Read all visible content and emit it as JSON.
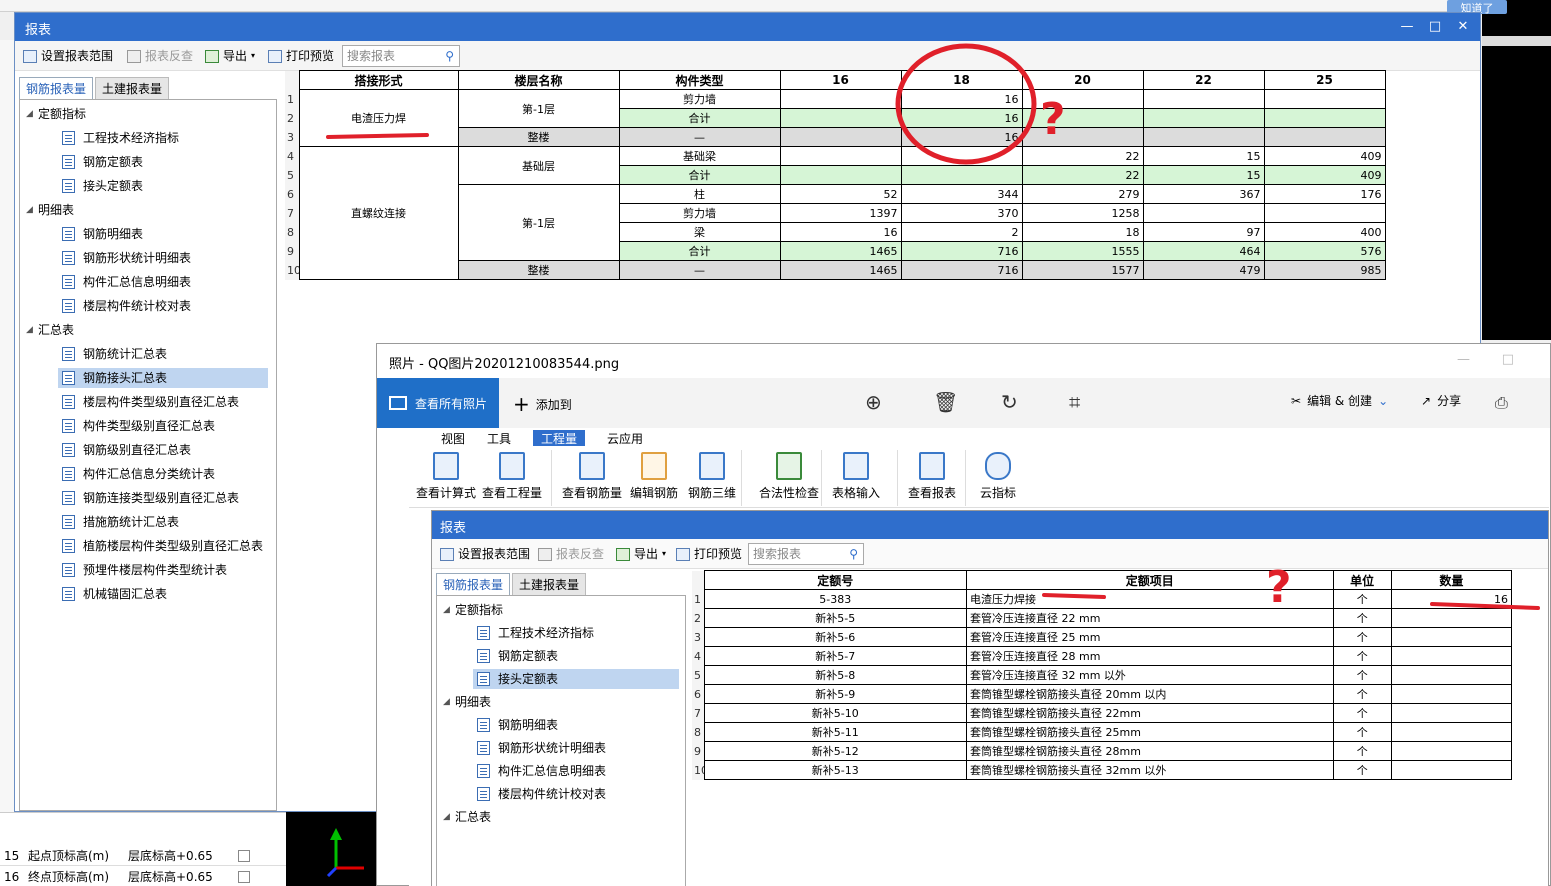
{
  "top_hint": "知道了",
  "bg_left_rows": [
    "15",
    "16"
  ],
  "bg_left_labels": [
    {
      "name": "起点顶标高(m)",
      "value": "层底标高+0.65"
    },
    {
      "name": "终点顶标高(m)",
      "value": "层底标高+0.65"
    }
  ],
  "report": {
    "title": "报表",
    "toolbar": {
      "set_range": "设置报表范围",
      "reverse": "报表反查",
      "export": "导出",
      "print_preview": "打印预览",
      "search_placeholder": "搜索报表"
    },
    "tabs": [
      "钢筋报表量",
      "土建报表量"
    ],
    "tree": {
      "g1": "定额指标",
      "g1_items": [
        "工程技术经济指标",
        "钢筋定额表",
        "接头定额表"
      ],
      "g2": "明细表",
      "g2_items": [
        "钢筋明细表",
        "钢筋形状统计明细表",
        "构件汇总信息明细表",
        "楼层构件统计校对表"
      ],
      "g3": "汇总表",
      "g3_items": [
        "钢筋统计汇总表",
        "钢筋接头汇总表",
        "楼层构件类型级别直径汇总表",
        "构件类型级别直径汇总表",
        "钢筋级别直径汇总表",
        "构件汇总信息分类统计表",
        "钢筋连接类型级别直径汇总表",
        "措施筋统计汇总表",
        "植筋楼层构件类型级别直径汇总表",
        "预埋件楼层构件类型统计表",
        "机械锚固汇总表"
      ]
    },
    "headers": [
      "搭接形式",
      "楼层名称",
      "构件类型",
      "16",
      "18",
      "20",
      "22",
      "25"
    ],
    "rows": [
      {
        "n": "1",
        "type": "剪力墙",
        "v": [
          "",
          "16",
          "",
          "",
          ""
        ]
      },
      {
        "n": "2",
        "type": "合计",
        "v": [
          "",
          "16",
          "",
          "",
          ""
        ]
      },
      {
        "n": "3",
        "type": "—",
        "v": [
          "",
          "16",
          "",
          "",
          ""
        ]
      },
      {
        "n": "4",
        "type": "基础梁",
        "v": [
          "",
          "",
          "22",
          "15",
          "409"
        ]
      },
      {
        "n": "5",
        "type": "合计",
        "v": [
          "",
          "",
          "22",
          "15",
          "409"
        ]
      },
      {
        "n": "6",
        "type": "柱",
        "v": [
          "52",
          "344",
          "279",
          "367",
          "176"
        ]
      },
      {
        "n": "7",
        "type": "剪力墙",
        "v": [
          "1397",
          "370",
          "1258",
          "",
          ""
        ]
      },
      {
        "n": "8",
        "type": "梁",
        "v": [
          "16",
          "2",
          "18",
          "97",
          "400"
        ]
      },
      {
        "n": "9",
        "type": "合计",
        "v": [
          "1465",
          "716",
          "1555",
          "464",
          "576"
        ]
      },
      {
        "n": "10",
        "type": "—",
        "v": [
          "1465",
          "716",
          "1577",
          "479",
          "985"
        ]
      }
    ],
    "merge": {
      "form1": "电渣压力焊",
      "form2": "直螺纹连接",
      "floor_b1": "第-1层",
      "whole": "整楼",
      "base": "基础层",
      "floor_b1b": "第-1层",
      "whole2": "整楼"
    }
  },
  "photos": {
    "title": "照片 - QQ图片20201210083544.png",
    "view_all": "查看所有照片",
    "add_to": "添加到",
    "edit_create": "编辑 & 创建",
    "share": "分享",
    "ribbon_tabs": [
      "视图",
      "工具",
      "工程量",
      "云应用"
    ],
    "ribbon_buttons": [
      "查看计算式",
      "查看工程量",
      "查看钢筋量",
      "编辑钢筋",
      "钢筋三维",
      "合法性检查",
      "表格输入",
      "查看报表",
      "云指标"
    ],
    "sub_title": "报表",
    "sub_toolbar": {
      "set_range": "设置报表范围",
      "reverse": "报表反查",
      "export": "导出",
      "print_preview": "打印预览",
      "search_placeholder": "搜索报表"
    },
    "sub_tabs": [
      "钢筋报表量",
      "土建报表量"
    ],
    "sub_tree": {
      "g1": "定额指标",
      "g1_items": [
        "工程技术经济指标",
        "钢筋定额表",
        "接头定额表"
      ],
      "g2": "明细表",
      "g2_items": [
        "钢筋明细表",
        "钢筋形状统计明细表",
        "构件汇总信息明细表",
        "楼层构件统计校对表"
      ],
      "g3": "汇总表"
    },
    "headers": [
      "定额号",
      "定额项目",
      "单位",
      "数量"
    ],
    "rows": [
      {
        "n": "1",
        "code": "5-383",
        "item": "电渣压力焊接",
        "unit": "个",
        "qty": "16"
      },
      {
        "n": "2",
        "code": "新补5-5",
        "item": "套管冷压连接直径 22 mm",
        "unit": "个",
        "qty": ""
      },
      {
        "n": "3",
        "code": "新补5-6",
        "item": "套管冷压连接直径 25 mm",
        "unit": "个",
        "qty": ""
      },
      {
        "n": "4",
        "code": "新补5-7",
        "item": "套管冷压连接直径 28 mm",
        "unit": "个",
        "qty": ""
      },
      {
        "n": "5",
        "code": "新补5-8",
        "item": "套管冷压连接直径 32 mm 以外",
        "unit": "个",
        "qty": ""
      },
      {
        "n": "6",
        "code": "新补5-9",
        "item": "套筒锥型螺栓钢筋接头直径 20mm 以内",
        "unit": "个",
        "qty": ""
      },
      {
        "n": "7",
        "code": "新补5-10",
        "item": "套筒锥型螺栓钢筋接头直径 22mm",
        "unit": "个",
        "qty": ""
      },
      {
        "n": "8",
        "code": "新补5-11",
        "item": "套筒锥型螺栓钢筋接头直径 25mm",
        "unit": "个",
        "qty": ""
      },
      {
        "n": "9",
        "code": "新补5-12",
        "item": "套筒锥型螺栓钢筋接头直径 28mm",
        "unit": "个",
        "qty": ""
      },
      {
        "n": "10",
        "code": "新补5-13",
        "item": "套筒锥型螺栓钢筋接头直径 32mm 以外",
        "unit": "个",
        "qty": ""
      }
    ]
  },
  "annotations": {
    "question_mark": "?"
  },
  "colors": {
    "accent": "#2f6ecc",
    "highlight_row": "#d6f5d6",
    "total_row": "#dcdcdc",
    "annotation": "#e0202a"
  }
}
